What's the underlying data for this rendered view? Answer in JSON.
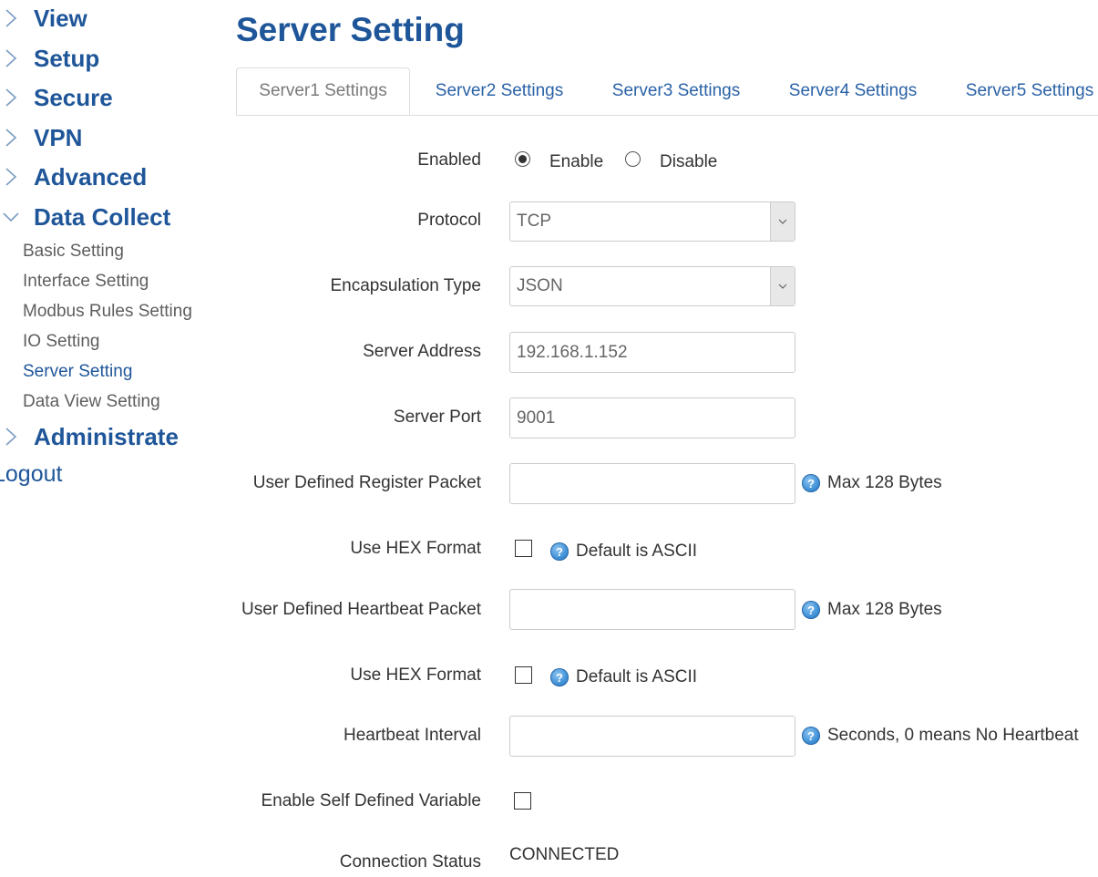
{
  "sidebar": {
    "menu": [
      {
        "label": "View",
        "icon": "chevron-right-icon",
        "expanded": false
      },
      {
        "label": "Setup",
        "icon": "chevron-right-icon",
        "expanded": false
      },
      {
        "label": "Secure",
        "icon": "chevron-right-icon",
        "expanded": false
      },
      {
        "label": "VPN",
        "icon": "chevron-right-icon",
        "expanded": false
      },
      {
        "label": "Advanced",
        "icon": "chevron-right-icon",
        "expanded": false
      },
      {
        "label": "Data Collect",
        "icon": "chevron-down-icon",
        "expanded": true
      },
      {
        "label": "Administrate",
        "icon": "chevron-right-icon",
        "expanded": false
      }
    ],
    "submenu": [
      {
        "label": "Basic Setting",
        "active": false
      },
      {
        "label": "Interface Setting",
        "active": false
      },
      {
        "label": "Modbus Rules Setting",
        "active": false
      },
      {
        "label": "IO Setting",
        "active": false
      },
      {
        "label": "Server Setting",
        "active": true
      },
      {
        "label": "Data View Setting",
        "active": false
      }
    ],
    "logout_label": "Logout"
  },
  "colors": {
    "brand_blue": "#1f5699",
    "tab_link": "#2a62a6",
    "muted_text": "#5e5e5e"
  },
  "page": {
    "title": "Server Setting",
    "tabs": [
      {
        "label": "Server1 Settings",
        "active": true
      },
      {
        "label": "Server2 Settings",
        "active": false
      },
      {
        "label": "Server3 Settings",
        "active": false
      },
      {
        "label": "Server4 Settings",
        "active": false
      },
      {
        "label": "Server5 Settings",
        "active": false
      }
    ]
  },
  "form": {
    "enabled": {
      "label": "Enabled",
      "options": [
        {
          "label": "Enable",
          "checked": true
        },
        {
          "label": "Disable",
          "checked": false
        }
      ]
    },
    "protocol": {
      "label": "Protocol",
      "value": "TCP"
    },
    "encapsulation": {
      "label": "Encapsulation Type",
      "value": "JSON"
    },
    "server_address": {
      "label": "Server Address",
      "value": "192.168.1.152",
      "placeholder": ""
    },
    "server_port": {
      "label": "Server Port",
      "value": "9001",
      "placeholder": ""
    },
    "register_packet": {
      "label": "User Defined Register Packet",
      "value": "",
      "hint": "Max 128 Bytes"
    },
    "register_hex": {
      "label": "Use HEX Format",
      "checked": false,
      "hint": "Default is ASCII"
    },
    "heartbeat_packet": {
      "label": "User Defined Heartbeat Packet",
      "value": "",
      "hint": "Max 128 Bytes"
    },
    "heartbeat_hex": {
      "label": "Use HEX Format",
      "checked": false,
      "hint": "Default is ASCII"
    },
    "heartbeat_interval": {
      "label": "Heartbeat Interval",
      "value": "",
      "hint": "Seconds, 0 means No Heartbeat"
    },
    "self_defined_variable": {
      "label": "Enable Self Defined Variable",
      "checked": false
    },
    "connection_status": {
      "label": "Connection Status",
      "value": "CONNECTED"
    }
  }
}
